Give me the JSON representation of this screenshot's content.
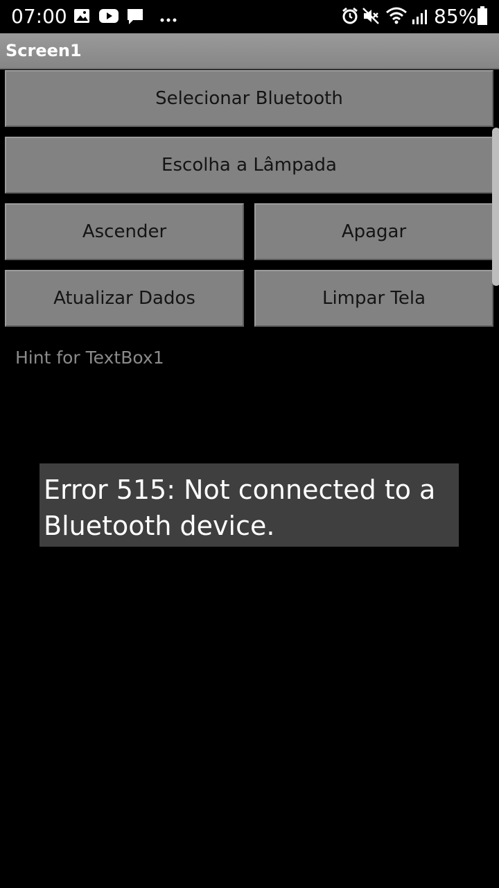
{
  "status_bar": {
    "time": "07:00",
    "battery_text": "85%",
    "left_icons": [
      "image-icon",
      "youtube-icon",
      "message-icon",
      "more-dots-icon"
    ],
    "right_icons": [
      "alarm-icon",
      "mute-icon",
      "wifi-icon",
      "signal-icon",
      "battery-icon"
    ]
  },
  "app": {
    "title": "Screen1"
  },
  "buttons": {
    "select_bluetooth": "Selecionar Bluetooth",
    "choose_lamp": "Escolha a Lâmpada",
    "turn_on": "Ascender",
    "turn_off": "Apagar",
    "update_data": "Atualizar Dados",
    "clear_screen": "Limpar Tela"
  },
  "textbox": {
    "hint": "Hint for TextBox1"
  },
  "toast": {
    "message": "Error 515: Not connected to a Bluetooth device."
  },
  "colors": {
    "background": "#000000",
    "button": "#828282",
    "titlebar": "#8f8f8f",
    "toast": "#3f3f3f"
  }
}
